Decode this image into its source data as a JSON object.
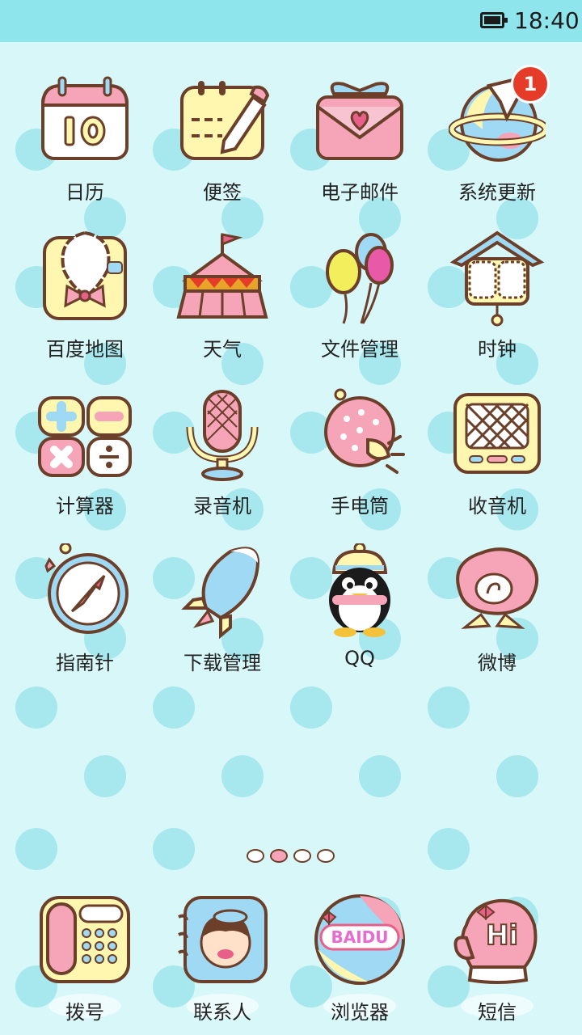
{
  "status_bar": {
    "time": "18:40"
  },
  "apps": [
    {
      "label": "日历",
      "icon": "calendar-icon"
    },
    {
      "label": "便签",
      "icon": "notepad-icon"
    },
    {
      "label": "电子邮件",
      "icon": "email-icon"
    },
    {
      "label": "系统更新",
      "icon": "system-update-icon",
      "badge": "1"
    },
    {
      "label": "百度地图",
      "icon": "map-icon"
    },
    {
      "label": "天气",
      "icon": "weather-tent-icon"
    },
    {
      "label": "文件管理",
      "icon": "balloons-icon"
    },
    {
      "label": "时钟",
      "icon": "cuckoo-clock-icon"
    },
    {
      "label": "计算器",
      "icon": "calculator-icon"
    },
    {
      "label": "录音机",
      "icon": "microphone-icon"
    },
    {
      "label": "手电筒",
      "icon": "flashlight-icon"
    },
    {
      "label": "收音机",
      "icon": "radio-icon"
    },
    {
      "label": "指南针",
      "icon": "compass-icon"
    },
    {
      "label": "下载管理",
      "icon": "rocket-icon"
    },
    {
      "label": "QQ",
      "icon": "qq-penguin-icon"
    },
    {
      "label": "微博",
      "icon": "weibo-icon"
    }
  ],
  "page_indicator": {
    "pages": 4,
    "current": 2
  },
  "dock": [
    {
      "label": "拨号",
      "icon": "phone-icon"
    },
    {
      "label": "联系人",
      "icon": "contacts-icon"
    },
    {
      "label": "浏览器",
      "icon": "browser-icon",
      "logo_text": "BAIDU"
    },
    {
      "label": "短信",
      "icon": "sms-mitten-icon",
      "logo_text": "Hi"
    }
  ],
  "colors": {
    "background": "#d8f7f9",
    "status_bar": "#8ee6ec",
    "dot": "#a7e7ee",
    "outline": "#6b3f2a",
    "pink": "#f6a4b8",
    "yellow": "#fff6b0",
    "blue": "#9fd9f3"
  }
}
